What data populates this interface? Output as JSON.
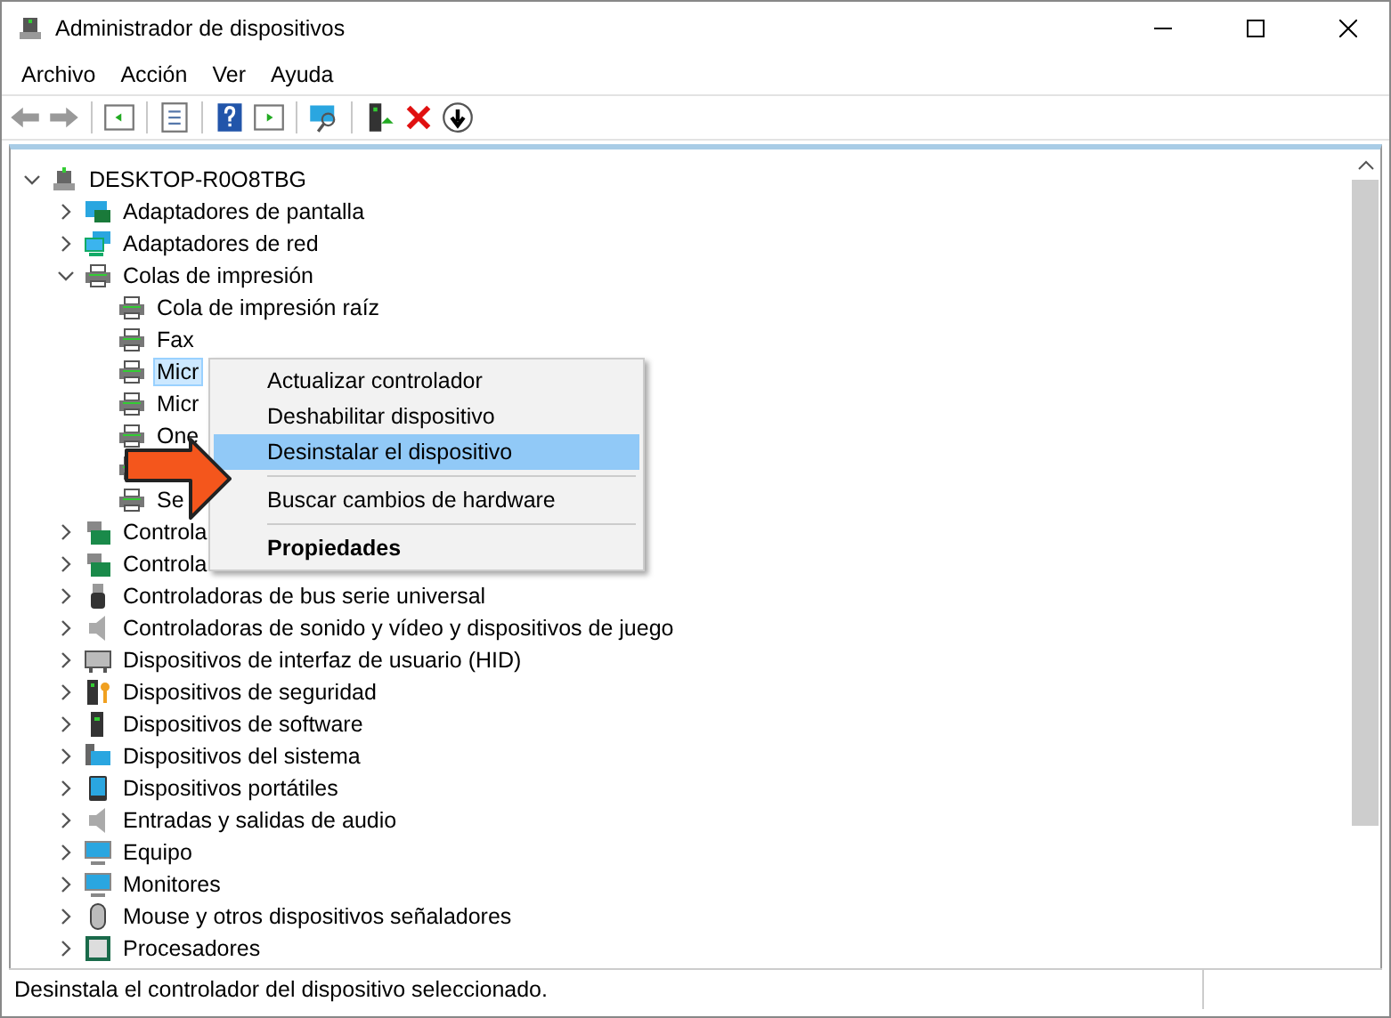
{
  "window": {
    "title": "Administrador de dispositivos"
  },
  "menu_bar": [
    "Archivo",
    "Acción",
    "Ver",
    "Ayuda"
  ],
  "tree": {
    "label": "DESKTOP-R0O8TBG",
    "expanded": true,
    "selected": false,
    "children": [
      {
        "label": "Adaptadores de pantalla",
        "expanded": false,
        "selected": false
      },
      {
        "label": "Adaptadores de red",
        "expanded": false,
        "selected": false
      },
      {
        "label": "Colas de impresión",
        "expanded": true,
        "selected": false,
        "children": [
          {
            "label": "Cola de impresión raíz",
            "selected": false
          },
          {
            "label": "Fax",
            "selected": false
          },
          {
            "label": "Micr",
            "selected": true
          },
          {
            "label": "Micr",
            "selected": false
          },
          {
            "label": "One",
            "selected": false
          },
          {
            "selected": false
          },
          {
            "label": "Se",
            "selected": false
          }
        ]
      },
      {
        "label": "Controla",
        "expanded": false,
        "selected": false
      },
      {
        "label": "Controla",
        "expanded": false,
        "selected": false
      },
      {
        "label": "Controladoras de bus serie universal",
        "expanded": false,
        "selected": false
      },
      {
        "label": "Controladoras de sonido y vídeo y dispositivos de juego",
        "expanded": false,
        "selected": false
      },
      {
        "label": "Dispositivos de interfaz de usuario (HID)",
        "expanded": false,
        "selected": false
      },
      {
        "label": "Dispositivos de seguridad",
        "expanded": false,
        "selected": false
      },
      {
        "label": "Dispositivos de software",
        "expanded": false,
        "selected": false
      },
      {
        "label": "Dispositivos del sistema",
        "expanded": false,
        "selected": false
      },
      {
        "label": "Dispositivos portátiles",
        "expanded": false,
        "selected": false
      },
      {
        "label": "Entradas y salidas de audio",
        "expanded": false,
        "selected": false
      },
      {
        "label": "Equipo",
        "expanded": false,
        "selected": false
      },
      {
        "label": "Monitores",
        "expanded": false,
        "selected": false
      },
      {
        "label": "Mouse y otros dispositivos señaladores",
        "expanded": false,
        "selected": false
      },
      {
        "label": "Procesadores",
        "expanded": false,
        "selected": false
      }
    ]
  },
  "context_menu": {
    "items": [
      {
        "kind": "item",
        "label": "Actualizar controlador",
        "selected": false,
        "default": false
      },
      {
        "kind": "item",
        "label": "Deshabilitar dispositivo",
        "selected": false,
        "default": false
      },
      {
        "kind": "item",
        "label": "Desinstalar el dispositivo",
        "selected": true,
        "default": false
      },
      {
        "kind": "separator"
      },
      {
        "kind": "item",
        "label": "Buscar cambios de hardware",
        "selected": false,
        "default": false
      },
      {
        "kind": "separator"
      },
      {
        "kind": "item",
        "label": "Propiedades",
        "selected": false,
        "default": true
      }
    ]
  },
  "status_bar": {
    "text": "Desinstala el controlador del dispositivo seleccionado."
  }
}
